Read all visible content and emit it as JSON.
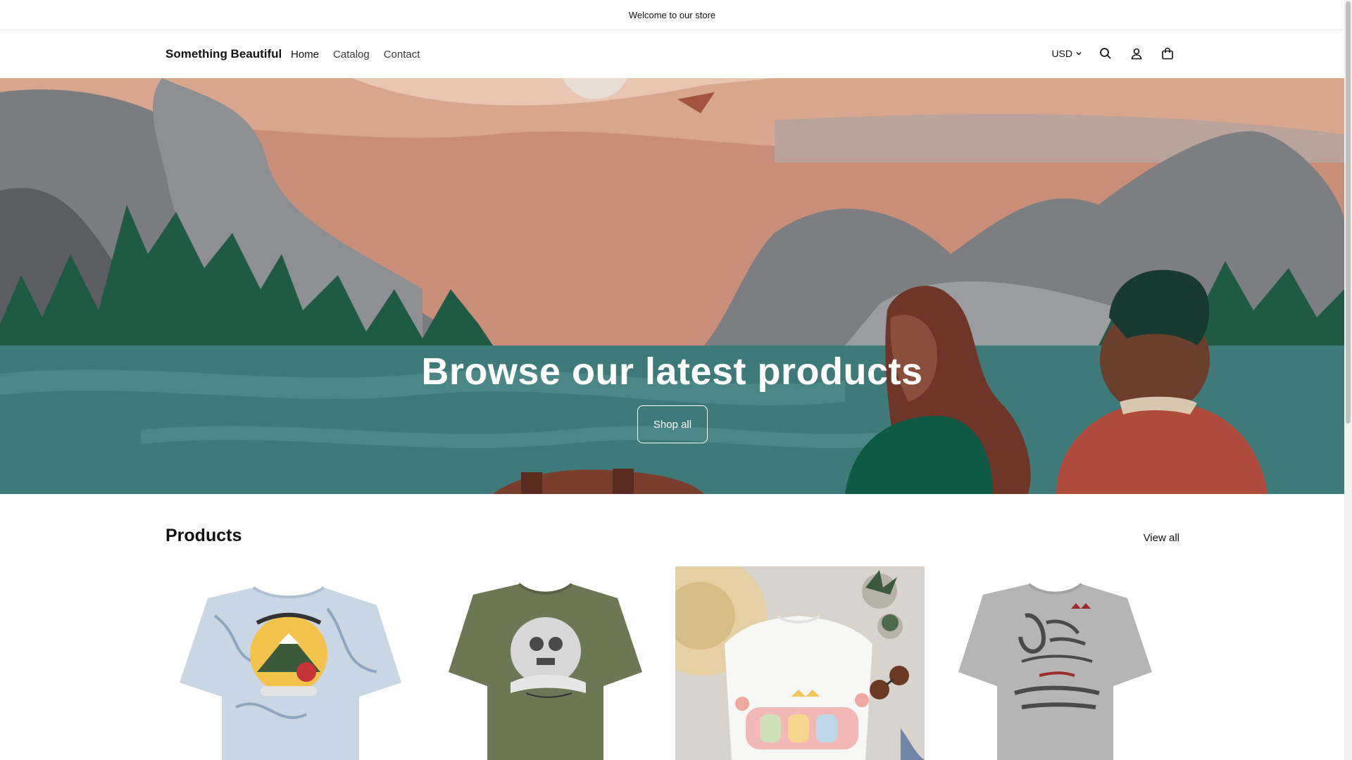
{
  "announcement": {
    "text": "Welcome to our store"
  },
  "header": {
    "logo": "Something Beautiful",
    "nav": [
      "Home",
      "Catalog",
      "Contact"
    ],
    "currency": "USD",
    "icons": [
      "search-icon",
      "account-icon",
      "cart-icon"
    ]
  },
  "hero": {
    "title": "Browse our latest products",
    "button": "Shop all"
  },
  "products": {
    "title": "Products",
    "view_all": "View all",
    "items": [
      {
        "image": "tie-dye t-shirt with volcano graphic"
      },
      {
        "image": "olive green t-shirt with skull graphic"
      },
      {
        "image": "white t-shirt flat lay with hat and sunglasses"
      },
      {
        "image": "gray t-shirt with lettering graphic"
      }
    ]
  },
  "colors": {
    "accent_text": "#121212",
    "hero_lake": "#3f7a7a",
    "hero_sky": "#c98e77"
  }
}
